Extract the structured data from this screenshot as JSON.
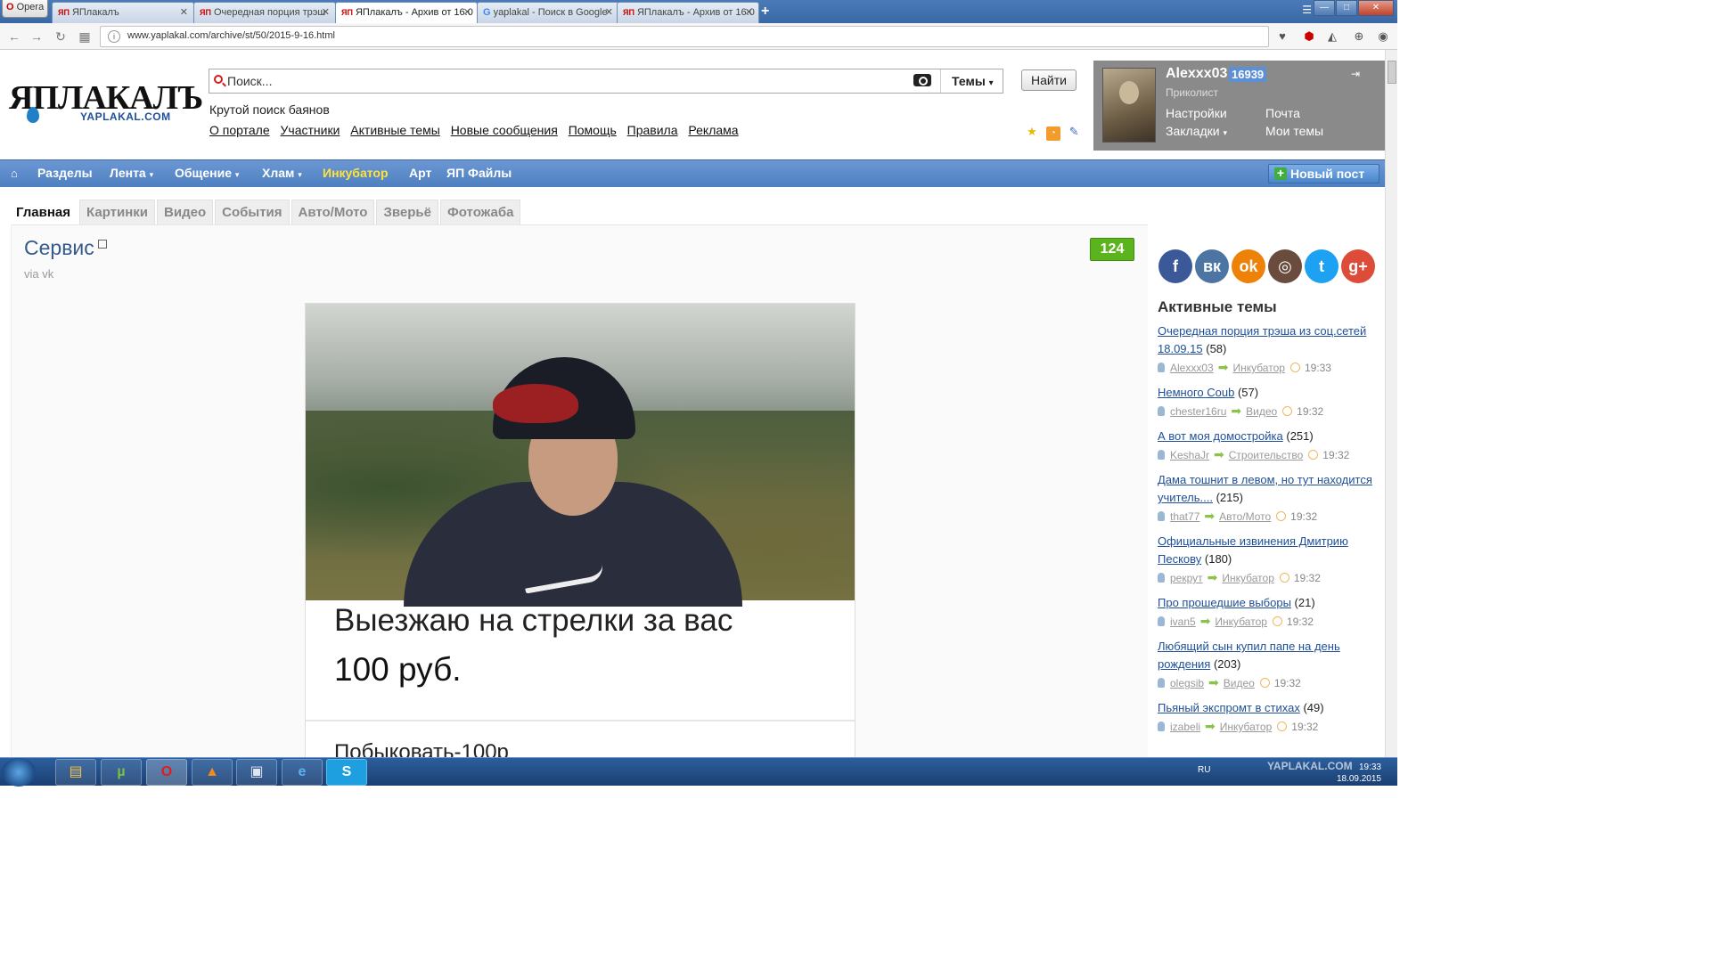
{
  "browser": {
    "menu_label": "Opera",
    "tabs": [
      {
        "title": "ЯПлакалъ",
        "fav": "ЯП",
        "active": false
      },
      {
        "title": "Очередная порция трэш",
        "fav": "ЯП",
        "active": false
      },
      {
        "title": "ЯПлакалъ - Архив от 16.0",
        "fav": "ЯП",
        "active": true
      },
      {
        "title": "yaplakal - Поиск в Google",
        "fav": "G",
        "active": false
      },
      {
        "title": "ЯПлакалъ - Архив от 16.0",
        "fav": "ЯП",
        "active": false
      }
    ],
    "url": "www.yaplakal.com/archive/st/50/2015-9-16.html"
  },
  "header": {
    "logo_text": "ЯПЛАКАЛЪ",
    "logo_sub": "YAPLAKAL.COM",
    "search_placeholder": "Поиск...",
    "search_scope": "Темы",
    "search_button": "Найти",
    "tagline": "Крутой поиск баянов",
    "links": [
      "О портале",
      "Участники",
      "Активные темы",
      "Новые сообщения",
      "Помощь",
      "Правила",
      "Реклама"
    ]
  },
  "user": {
    "name": "Alexxx03",
    "rep": "16939",
    "rank": "Приколист",
    "settings": "Настройки",
    "mail": "Почта",
    "bookmarks": "Закладки",
    "my_topics": "Мои темы"
  },
  "nav": {
    "items": [
      "Разделы",
      "Лента",
      "Общение",
      "Хлам",
      "Инкубатор",
      "Арт",
      "ЯП Файлы"
    ],
    "new_post": "Новый пост"
  },
  "content_tabs": [
    "Главная",
    "Картинки",
    "Видео",
    "События",
    "Авто/Мото",
    "Зверьё",
    "Фотожаба"
  ],
  "post": {
    "title": "Сервис",
    "via": "via vk",
    "rating": "124",
    "caption_line1": "Выезжаю на стрелки за вас",
    "caption_line2": "100 руб.",
    "caption_line3": "Побыковать-100р"
  },
  "sidebar": {
    "title": "Активные темы",
    "social": [
      {
        "icon": "facebook-icon",
        "glyph": "f",
        "color": "#3b5998"
      },
      {
        "icon": "vk-icon",
        "glyph": "вк",
        "color": "#4c75a3"
      },
      {
        "icon": "odnoklassniki-icon",
        "glyph": "ok",
        "color": "#ee8208"
      },
      {
        "icon": "instagram-icon",
        "glyph": "◎",
        "color": "#6a4c3e"
      },
      {
        "icon": "twitter-icon",
        "glyph": "t",
        "color": "#1da1f2"
      },
      {
        "icon": "google-plus-icon",
        "glyph": "g+",
        "color": "#dd4b39"
      }
    ],
    "topics": [
      {
        "title": "Очередная порция трэша из соц.сетей 18.09.15",
        "count": "(58)",
        "author": "Alexxx03",
        "section": "Инкубатор",
        "time": "19:33"
      },
      {
        "title": "Немного Coub",
        "count": "(57)",
        "author": "chester16ru",
        "section": "Видео",
        "time": "19:32"
      },
      {
        "title": "А вот моя домостройка",
        "count": "(251)",
        "author": "KeshaJr",
        "section": "Строительство",
        "time": "19:32"
      },
      {
        "title": "Дама тошнит в левом, но тут находится учитель....",
        "count": "(215)",
        "author": "that77",
        "section": "Авто/Мото",
        "time": "19:32"
      },
      {
        "title": "Официальные извинения Дмитрию Пескову",
        "count": "(180)",
        "author": "рекрут",
        "section": "Инкубатор",
        "time": "19:32"
      },
      {
        "title": "Про прошедшие выборы",
        "count": "(21)",
        "author": "ivan5",
        "section": "Инкубатор",
        "time": "19:32"
      },
      {
        "title": "Любящий сын купил папе на день рождения",
        "count": "(203)",
        "author": "olegsib",
        "section": "Видео",
        "time": "19:32"
      },
      {
        "title": "Пьяный экспромт в стихах",
        "count": "(49)",
        "author": "izabeli",
        "section": "Инкубатор",
        "time": "19:32"
      }
    ]
  },
  "taskbar": {
    "lang": "RU",
    "time": "19:33",
    "date": "18.09.2015",
    "watermark": "YAPLAKAL.COM"
  }
}
